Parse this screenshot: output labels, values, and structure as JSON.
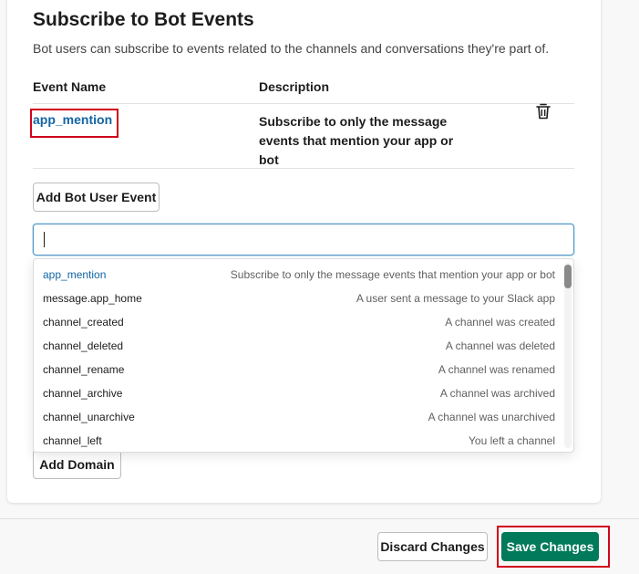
{
  "section": {
    "title": "Subscribe to Bot Events",
    "description": "Bot users can subscribe to events related to the channels and conversations they're part of."
  },
  "table": {
    "headers": {
      "name": "Event Name",
      "description": "Description"
    },
    "rows": [
      {
        "name": "app_mention",
        "description": "Subscribe to only the message events that mention your app or bot"
      }
    ]
  },
  "buttons": {
    "add_bot_event": "Add Bot User Event",
    "add_domain": "Add Domain",
    "discard": "Discard Changes",
    "save": "Save Changes"
  },
  "search": {
    "value": "",
    "placeholder": ""
  },
  "dropdown": {
    "items": [
      {
        "name": "app_mention",
        "description": "Subscribe to only the message events that mention your app or bot"
      },
      {
        "name": "message.app_home",
        "description": "A user sent a message to your Slack app"
      },
      {
        "name": "channel_created",
        "description": "A channel was created"
      },
      {
        "name": "channel_deleted",
        "description": "A channel was deleted"
      },
      {
        "name": "channel_rename",
        "description": "A channel was renamed"
      },
      {
        "name": "channel_archive",
        "description": "A channel was archived"
      },
      {
        "name": "channel_unarchive",
        "description": "A channel was unarchived"
      },
      {
        "name": "channel_left",
        "description": "You left a channel"
      }
    ]
  },
  "icons": {
    "delete": "trash-icon"
  },
  "colors": {
    "link": "#1264a3",
    "save_button": "#007a5a",
    "highlight_box": "#d0021b"
  }
}
